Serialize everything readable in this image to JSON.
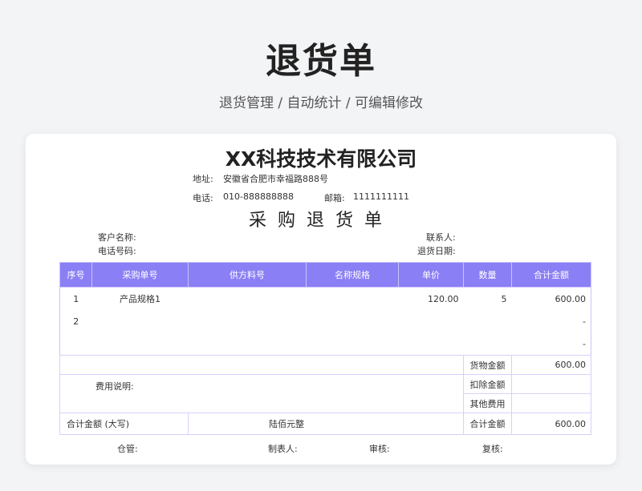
{
  "hero": {
    "title": "退货单",
    "subtitle": "退货管理 / 自动统计 /  可编辑修改"
  },
  "doc": {
    "company": "XX科技技术有限公司",
    "address_label": "地址:",
    "address": "安徽省合肥市幸福路888号",
    "phone_label": "电话:",
    "phone": "010-888888888",
    "email_label": "邮箱:",
    "email": "1111111111",
    "title": "采购退货单",
    "customer_label": "客户名称:",
    "contact_label": "联系人:",
    "tel_label": "电话号码:",
    "return_date_label": "退货日期:"
  },
  "table": {
    "headers": [
      "序号",
      "采购单号",
      "供方料号",
      "名称规格",
      "单价",
      "数量",
      "合计金额"
    ],
    "rows": [
      {
        "no": "1",
        "order": "产品规格1",
        "supplier": "",
        "spec": "",
        "price": "120.00",
        "qty": "5",
        "amount": "600.00"
      },
      {
        "no": "2",
        "order": "",
        "supplier": "",
        "spec": "",
        "price": "",
        "qty": "",
        "amount": "-"
      },
      {
        "no": "",
        "order": "",
        "supplier": "",
        "spec": "",
        "price": "",
        "qty": "",
        "amount": "-"
      }
    ],
    "goods_amount_label": "货物金额",
    "goods_amount": "600.00",
    "fee_note_label": "费用说明:",
    "deduct_label": "扣除金额",
    "deduct": "",
    "other_fee_label": "其他费用",
    "other_fee": "",
    "total_upper_label": "合计金额 (大写)",
    "total_upper": "陆佰元整",
    "total_label": "合计金额",
    "total": "600.00"
  },
  "signatures": {
    "warehouse": "仓管:",
    "maker": "制表人:",
    "reviewer": "审核:",
    "recheck": "复核:"
  }
}
